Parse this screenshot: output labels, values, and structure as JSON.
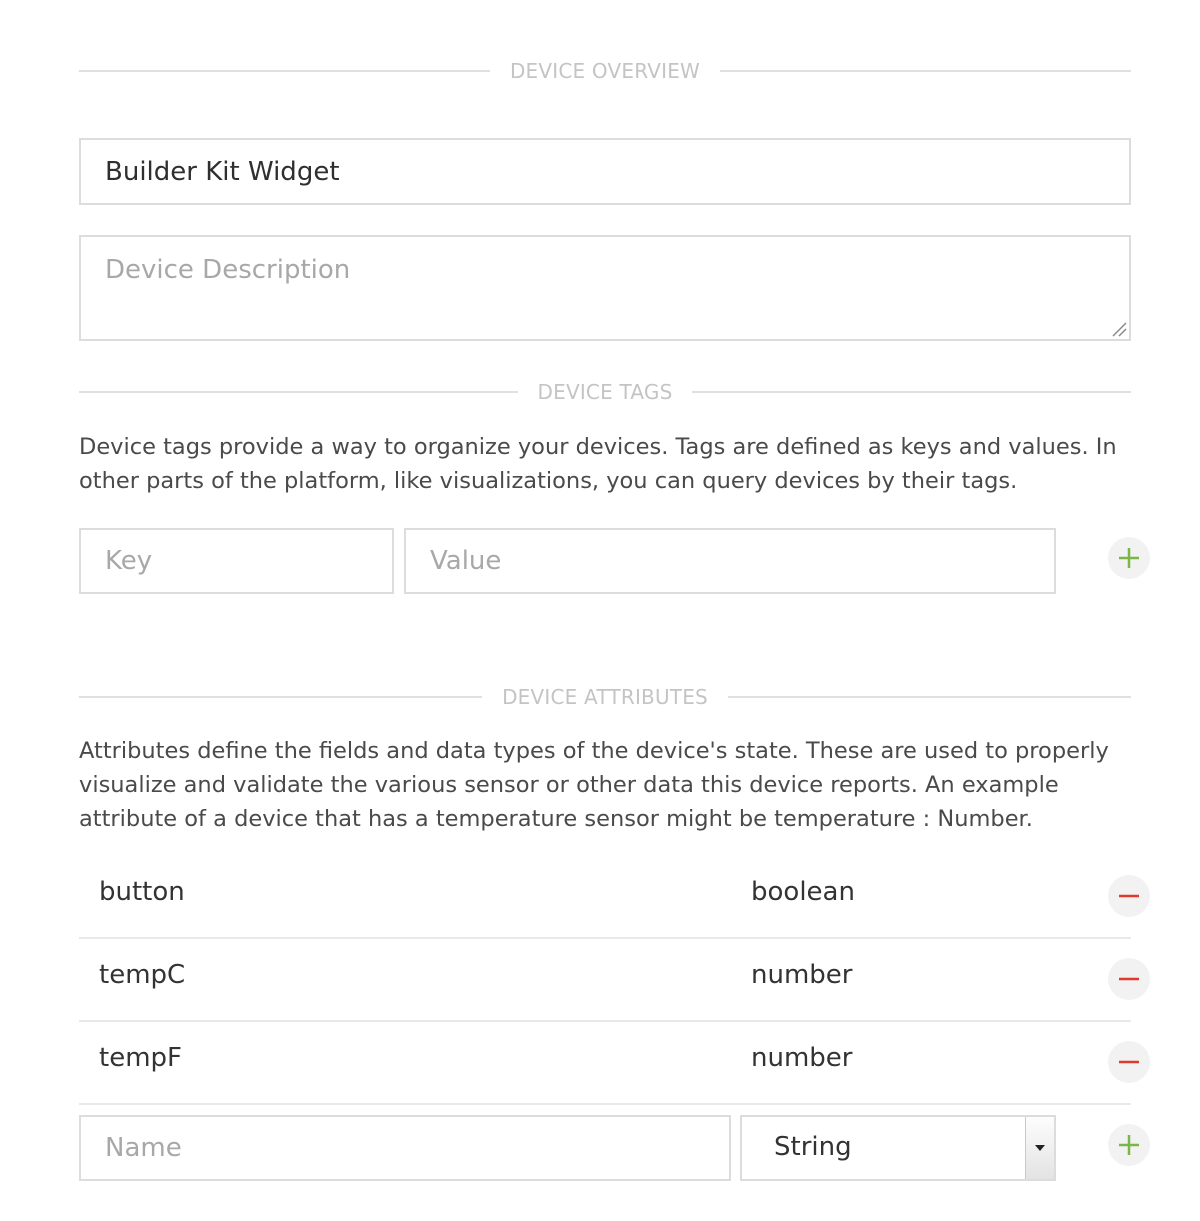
{
  "overview": {
    "header": "DEVICE OVERVIEW",
    "name_value": "Builder Kit Widget",
    "description_placeholder": "Device Description"
  },
  "tags": {
    "header": "DEVICE TAGS",
    "description": "Device tags provide a way to organize your devices. Tags are defined as keys and values. In other parts of the platform, like visualizations, you can query devices by their tags.",
    "key_placeholder": "Key",
    "value_placeholder": "Value",
    "add_icon": "plus-icon"
  },
  "attributes": {
    "header": "DEVICE ATTRIBUTES",
    "description": "Attributes define the fields and data types of the device's state. These are used to properly visualize and validate the various sensor or other data this device reports. An example attribute of a device that has a temperature sensor might be temperature : Number.",
    "rows": [
      {
        "name": "button",
        "type": "boolean"
      },
      {
        "name": "tempC",
        "type": "number"
      },
      {
        "name": "tempF",
        "type": "number"
      }
    ],
    "remove_icon": "minus-icon",
    "new_name_placeholder": "Name",
    "new_type_selected": "String",
    "add_icon": "plus-icon"
  },
  "colors": {
    "add": "#7ab648",
    "remove": "#e03a2f",
    "border": "#dcdcdc",
    "header_text": "#c4c4c4"
  }
}
